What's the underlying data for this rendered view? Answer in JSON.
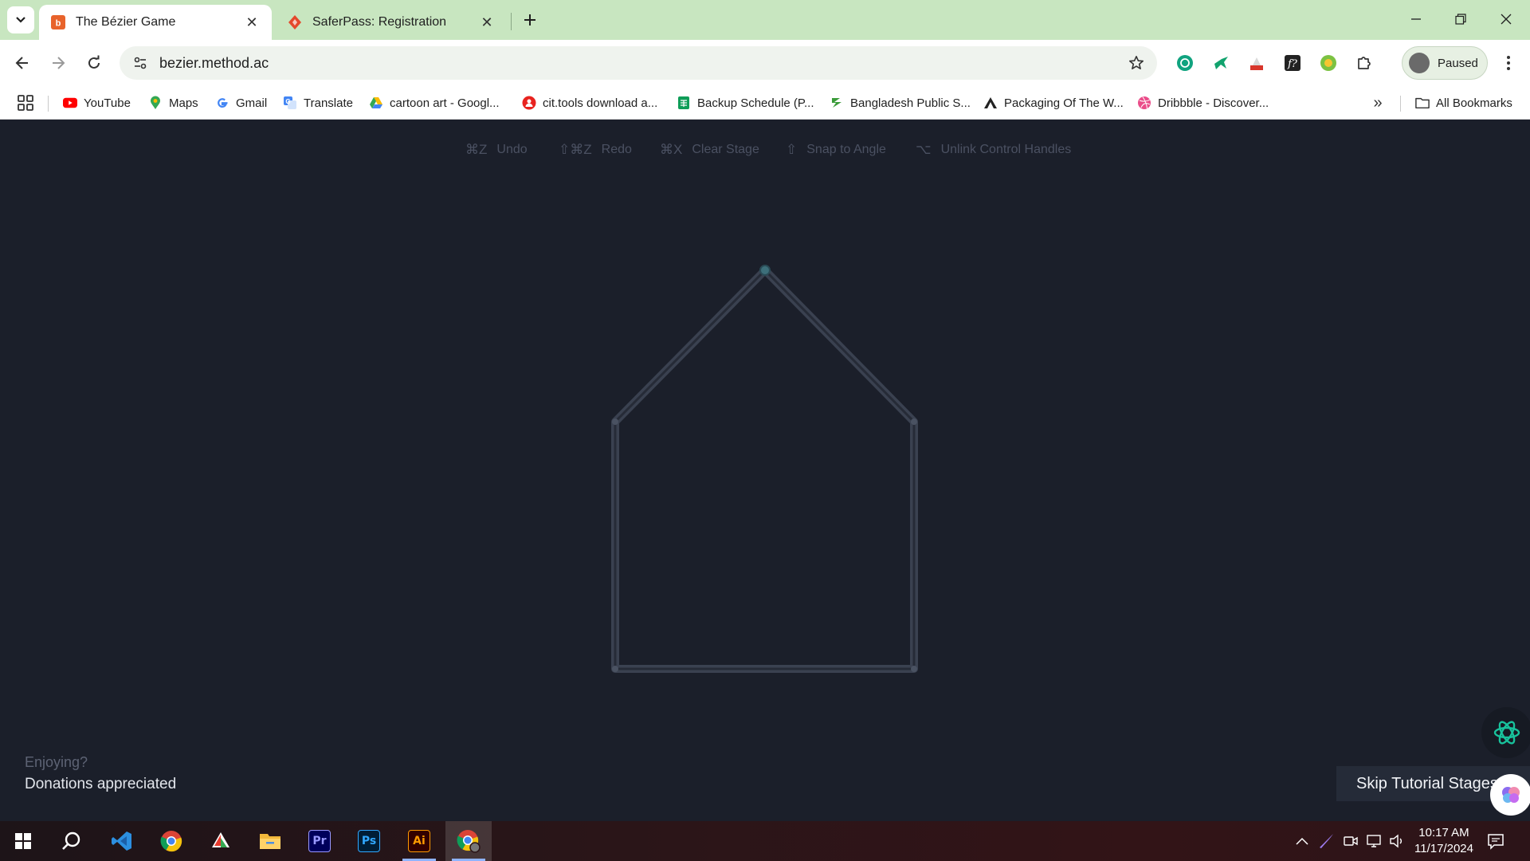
{
  "browser": {
    "tabs": [
      {
        "title": "The Bézier Game",
        "favicon": "bezier-game-favicon",
        "active": true
      },
      {
        "title": "SaferPass: Registration",
        "favicon": "saferpass-favicon",
        "active": false
      }
    ],
    "address": {
      "url": "bezier.method.ac"
    },
    "profile": {
      "label": "Paused"
    },
    "bookmarks": [
      {
        "label": "YouTube",
        "icon": "youtube-icon"
      },
      {
        "label": "Maps",
        "icon": "maps-pin-icon"
      },
      {
        "label": "Gmail",
        "icon": "google-g-icon"
      },
      {
        "label": "Translate",
        "icon": "translate-icon"
      },
      {
        "label": "cartoon art - Googl...",
        "icon": "google-drive-icon"
      },
      {
        "label": "cit.tools download a...",
        "icon": "cit-tools-icon"
      },
      {
        "label": "Backup Schedule (P...",
        "icon": "google-sheets-icon"
      },
      {
        "label": "Bangladesh Public S...",
        "icon": "bps-icon"
      },
      {
        "label": "Packaging Of The W...",
        "icon": "packaging-icon"
      },
      {
        "label": "Dribbble - Discover...",
        "icon": "dribbble-icon"
      }
    ],
    "all_bookmarks": "All Bookmarks"
  },
  "game": {
    "toolbar": [
      {
        "key": "⌘Z",
        "label": "Undo"
      },
      {
        "key": "⇧⌘Z",
        "label": "Redo"
      },
      {
        "key": "⌘X",
        "label": "Clear Stage"
      },
      {
        "key": "⇧",
        "label": "Snap to Angle"
      },
      {
        "key": "⌥",
        "label": "Unlink Control Handles"
      }
    ],
    "donate": {
      "question": "Enjoying?",
      "text": "Donations appreciated"
    },
    "skip_label": "Skip Tutorial Stages",
    "colors": {
      "background": "#1b1f2a",
      "shape_stroke": "#3a4150",
      "start_point": "#3d6f7a"
    }
  },
  "taskbar": {
    "apps": [
      {
        "name": "search",
        "icon": "search-icon"
      },
      {
        "name": "vscode",
        "icon": "vscode-icon"
      },
      {
        "name": "chrome",
        "icon": "chrome-icon"
      },
      {
        "name": "acrobat",
        "icon": "acrobat-icon"
      },
      {
        "name": "file-explorer",
        "icon": "folder-icon"
      },
      {
        "name": "premiere",
        "icon": "premiere-icon",
        "text": "Pr"
      },
      {
        "name": "photoshop",
        "icon": "photoshop-icon",
        "text": "Ps"
      },
      {
        "name": "illustrator",
        "icon": "illustrator-icon",
        "text": "Ai"
      },
      {
        "name": "chrome-profile",
        "icon": "chrome-profile-icon"
      }
    ],
    "clock": {
      "time": "10:17 AM",
      "date": "11/17/2024"
    }
  }
}
